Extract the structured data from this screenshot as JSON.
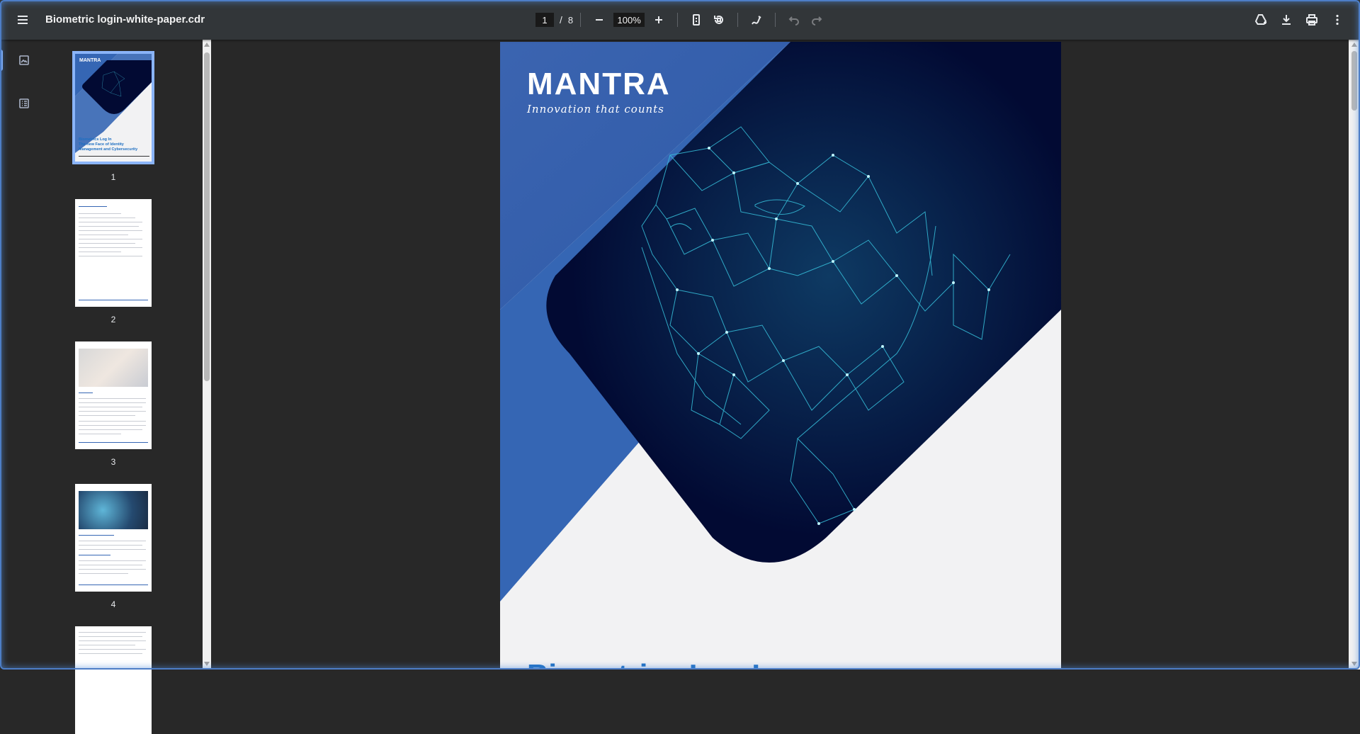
{
  "toolbar": {
    "title": "Biometric login-white-paper.cdr",
    "current_page": "1",
    "page_separator": "/",
    "total_pages": "8",
    "zoom": "100%"
  },
  "thumbnails": [
    {
      "label": "1"
    },
    {
      "label": "2"
    },
    {
      "label": "3"
    },
    {
      "label": "4"
    }
  ],
  "thumbnail_1": {
    "logo": "MANTRA",
    "title_lines": [
      "Biometrics Log In",
      "The new Face of Identity",
      "Management and Cybersecurity"
    ]
  },
  "document": {
    "logo": "MANTRA",
    "tagline": "Innovation that counts",
    "title": "Biometrics Log In"
  },
  "colors": {
    "accent": "#8ab4f8",
    "brand_blue": "#3566b4",
    "navy": "#020a33",
    "title_blue": "#1e6fc2"
  }
}
